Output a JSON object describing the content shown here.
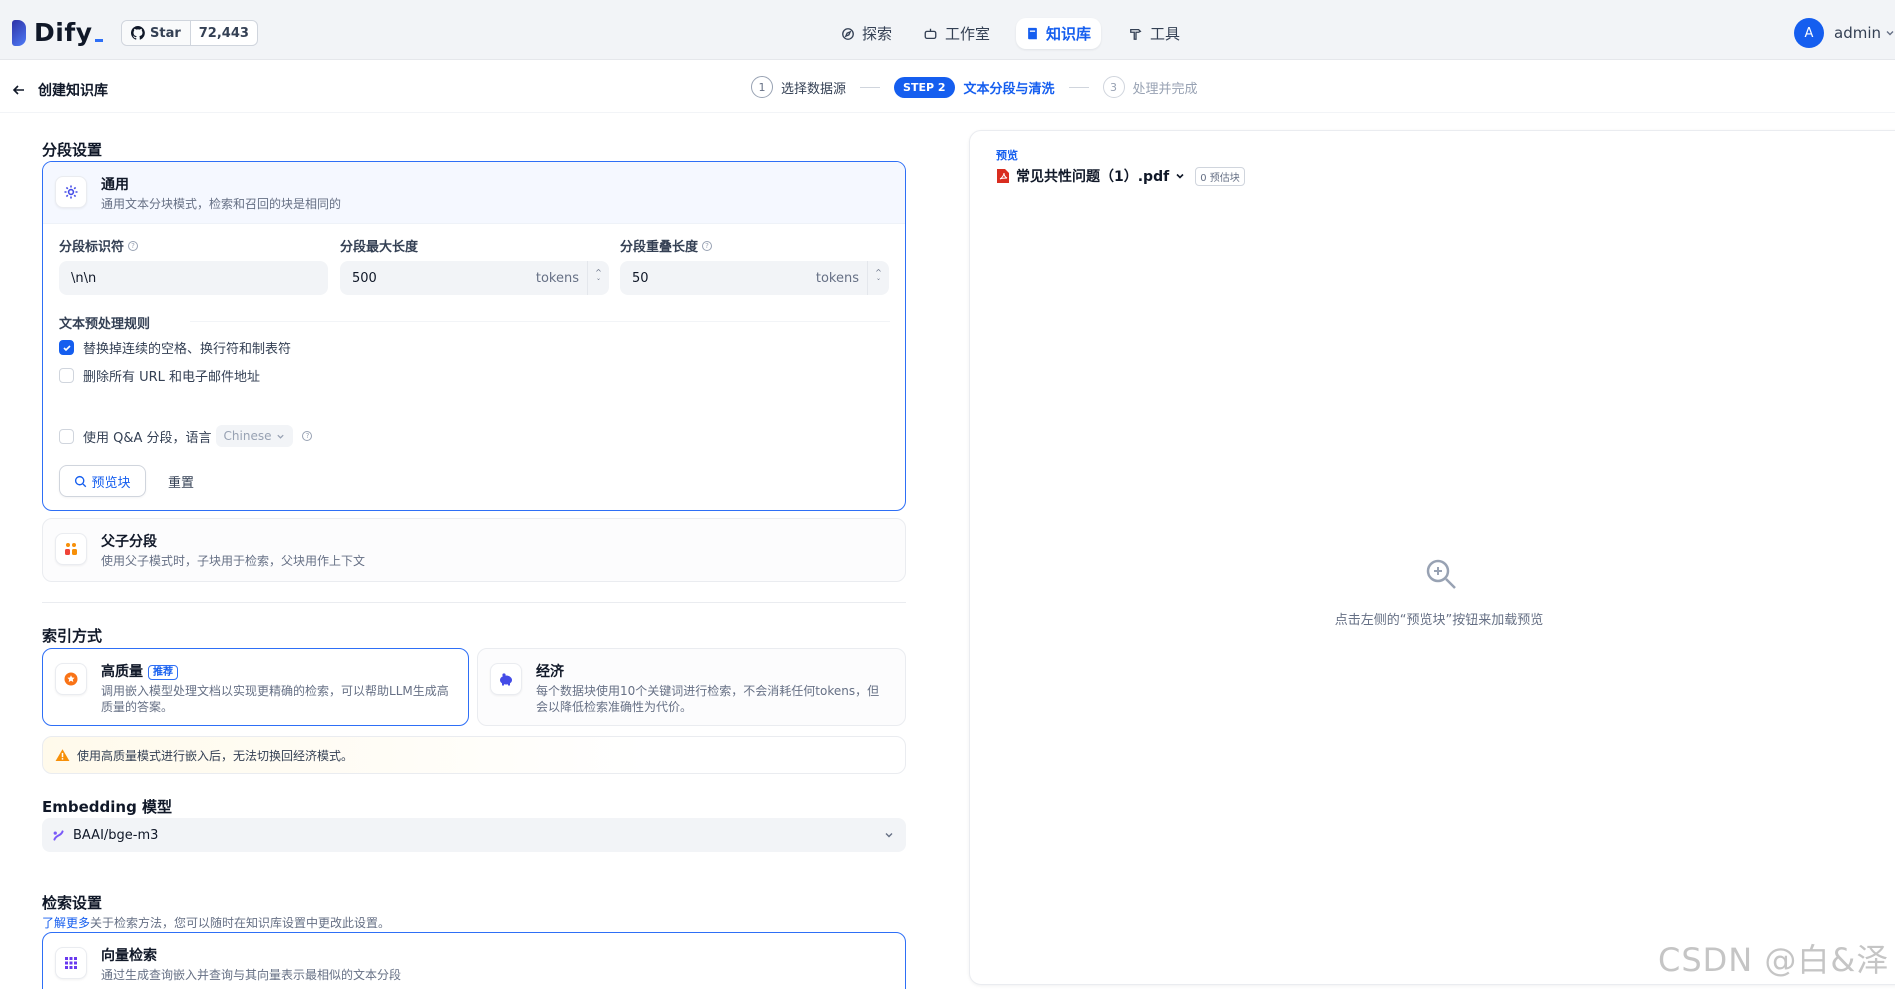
{
  "app": {
    "name": "Dify"
  },
  "github": {
    "star_label": "Star",
    "star_count": "72,443"
  },
  "nav": [
    {
      "label": "探索",
      "icon": "compass-icon"
    },
    {
      "label": "工作室",
      "icon": "robot-icon"
    },
    {
      "label": "知识库",
      "icon": "book-icon",
      "active": true
    },
    {
      "label": "工具",
      "icon": "hammer-icon"
    }
  ],
  "user": {
    "initial": "A",
    "name": "admin"
  },
  "page": {
    "back_title": "创建知识库"
  },
  "steps": [
    {
      "num": "1",
      "label": "选择数据源"
    },
    {
      "pill": "STEP 2",
      "label": "文本分段与清洗"
    },
    {
      "num": "3",
      "label": "处理并完成"
    }
  ],
  "segment": {
    "section_title": "分段设置",
    "general": {
      "title": "通用",
      "desc": "通用文本分块模式，检索和召回的块是相同的"
    },
    "separator": {
      "label": "分段标识符",
      "value": "\\n\\n"
    },
    "max_length": {
      "label": "分段最大长度",
      "value": "500",
      "unit": "tokens"
    },
    "overlap": {
      "label": "分段重叠长度",
      "value": "50",
      "unit": "tokens"
    },
    "rules_title": "文本预处理规则",
    "rule1": {
      "label": "替换掉连续的空格、换行符和制表符",
      "checked": true
    },
    "rule2": {
      "label": "删除所有 URL 和电子邮件地址",
      "checked": false
    },
    "qa": {
      "label": "使用 Q&A 分段，语言",
      "language": "Chinese"
    },
    "preview_button": "预览块",
    "reset_button": "重置",
    "parent_child": {
      "title": "父子分段",
      "desc": "使用父子模式时，子块用于检索，父块用作上下文"
    }
  },
  "index": {
    "section_title": "索引方式",
    "high": {
      "title": "高质量",
      "badge": "推荐",
      "desc": "调用嵌入模型处理文档以实现更精确的检索，可以帮助LLM生成高质量的答案。"
    },
    "economy": {
      "title": "经济",
      "desc": "每个数据块使用10个关键词进行检索，不会消耗任何tokens，但会以降低检索准确性为代价。"
    },
    "warning": "使用高质量模式进行嵌入后，无法切换回经济模式。"
  },
  "embedding": {
    "section_title": "Embedding 模型",
    "model": "BAAI/bge-m3"
  },
  "retrieval": {
    "section_title": "检索设置",
    "learn_more": "了解更多",
    "hint": "关于检索方法，您可以随时在知识库设置中更改此设置。",
    "vector": {
      "title": "向量检索",
      "desc": "通过生成查询嵌入并查询与其向量表示最相似的文本分段"
    }
  },
  "preview": {
    "label": "预览",
    "file_name": "常见共性问题（1）.pdf",
    "chunk_count": "0 预估块",
    "empty_text": "点击左侧的“预览块”按钮来加载预览"
  },
  "watermark": "CSDN @白&泽"
}
